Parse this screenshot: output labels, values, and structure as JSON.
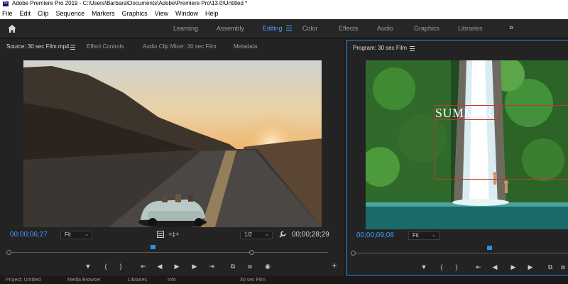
{
  "titlebar": {
    "logo": "Pr",
    "text": "Adobe Premiere Pro 2019 - C:\\Users\\Barbara\\Documents\\Adobe\\Premiere Pro\\13.0\\Untitled *"
  },
  "menu": [
    "File",
    "Edit",
    "Clip",
    "Sequence",
    "Markers",
    "Graphics",
    "View",
    "Window",
    "Help"
  ],
  "workspaces": {
    "tabs": [
      "Learning",
      "Assembly",
      "Editing",
      "Color",
      "Effects",
      "Audio",
      "Graphics",
      "Libraries"
    ],
    "active": "Editing",
    "more": "»"
  },
  "source": {
    "tabs": [
      "Source: 30 sec Film.mp4",
      "Effect Controls",
      "Audio Clip Mixer: 30 sec Film",
      "Metadata"
    ],
    "timecode_in": "00;00;06;27",
    "fit": "Fit",
    "resolution": "1/2",
    "timecode_out": "00;00;28;29",
    "playhead_fraction": 0.45
  },
  "program": {
    "tab": "Program: 30 sec Film",
    "timecode_in": "00;00;09;08",
    "fit": "Fit",
    "title_text": "SUMMER",
    "playhead_fraction": 0.63
  },
  "transport_glyphs": {
    "marker": "▼",
    "in": "{",
    "out": "}",
    "go_in": "⇤",
    "step_back": "◀",
    "play": "▶",
    "step_fwd": "▶",
    "go_out": "⇥",
    "insert": "⧉",
    "overwrite": "⧇",
    "export": "◉",
    "add": "+"
  },
  "bottom": [
    "Project: Untitled",
    "Media Browser",
    "Libraries",
    "Info",
    "30 sec Film"
  ],
  "colors": {
    "accent": "#2f8ded",
    "timecode": "#3f9cff",
    "bg": "#232323"
  }
}
